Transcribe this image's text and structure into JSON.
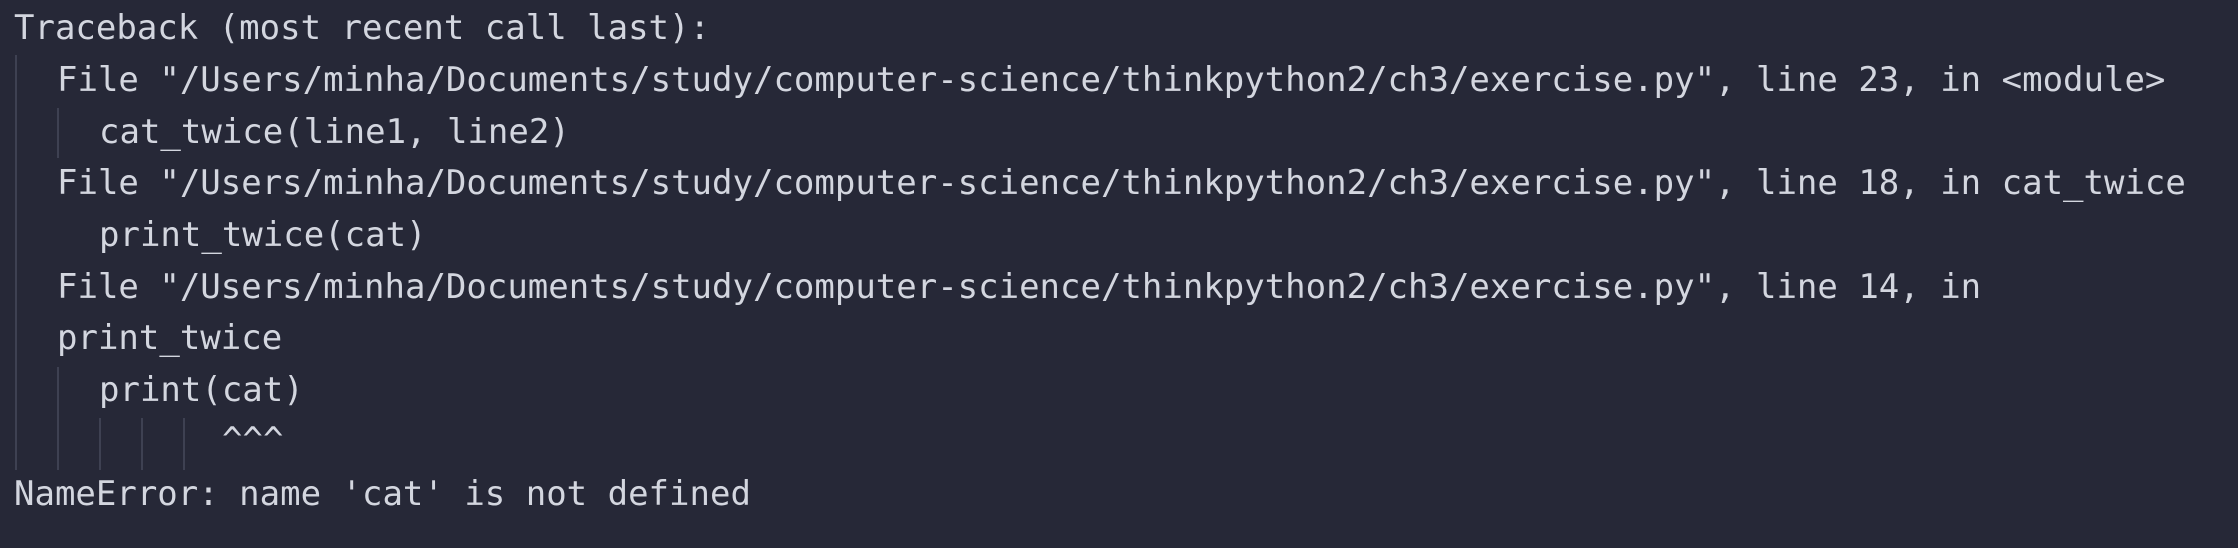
{
  "traceback": {
    "header": "Traceback (most recent call last):",
    "frame1": {
      "file_line": "File \"/Users/minha/Documents/study/computer-science/thinkpython2/ch3/exercise.py\", line 23, in <module>",
      "code": "cat_twice(line1, line2)"
    },
    "frame2": {
      "file_line": "File \"/Users/minha/Documents/study/computer-science/thinkpython2/ch3/exercise.py\", line 18, in cat_twice",
      "code": "print_twice(cat)"
    },
    "frame3": {
      "file_line": "File \"/Users/minha/Documents/study/computer-science/thinkpython2/ch3/exercise.py\", line 14, in",
      "file_line_wrap": "print_twice",
      "code": "print(cat)",
      "marker": "^^^"
    },
    "error": "NameError: name 'cat' is not defined"
  },
  "colors": {
    "background": "#262837",
    "text": "#d3d6df",
    "indent_guide": "#3e4152"
  }
}
